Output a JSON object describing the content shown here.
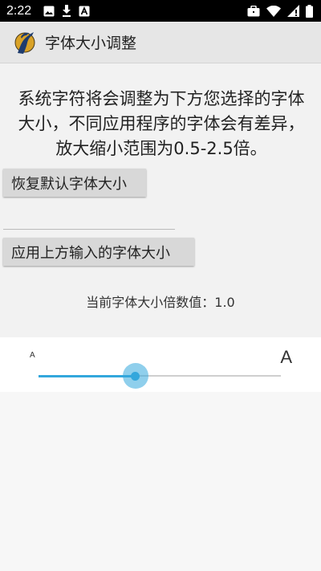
{
  "status_bar": {
    "time": "2:22",
    "icons": [
      "image-icon",
      "download-icon",
      "a-app-icon",
      "briefcase-icon",
      "wifi-icon",
      "signal-icon",
      "battery-icon"
    ]
  },
  "app_bar": {
    "title": "字体大小调整",
    "icon": "app-logo-icon"
  },
  "description": "系统字符将会调整为下方您选择的字体大小，不同应用程序的字体会有差异，放大缩小范围为0.5-2.5倍。",
  "buttons": {
    "reset_label": "恢复默认字体大小",
    "apply_label": "应用上方输入的字体大小"
  },
  "size_input": {
    "value": "",
    "placeholder": ""
  },
  "current_value_text": "当前字体大小倍数值：1.0",
  "slider": {
    "small_label": "A",
    "large_label": "A",
    "position_fraction": 0.4,
    "accent_color": "#33a7dc"
  }
}
